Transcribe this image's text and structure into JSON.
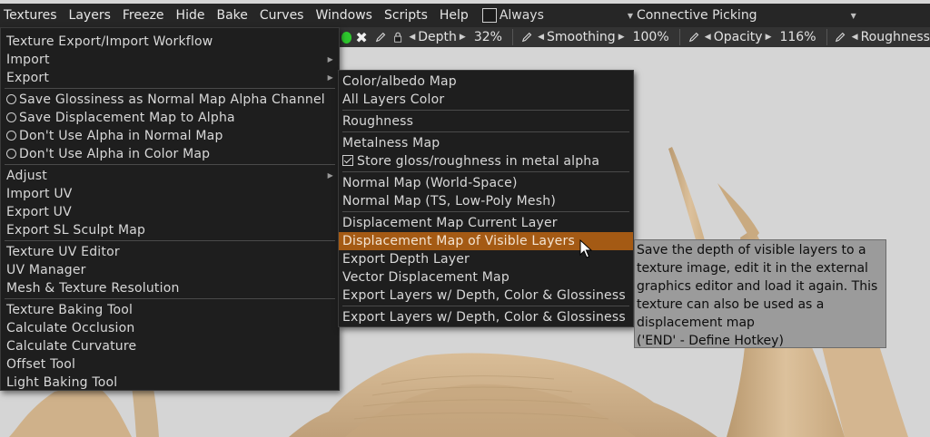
{
  "menubar": {
    "items": [
      "Textures",
      "Layers",
      "Freeze",
      "Hide",
      "Bake",
      "Curves",
      "Windows",
      "Scripts",
      "Help"
    ],
    "always_label": "Always",
    "picking_value": "Connective Picking"
  },
  "toolbar": {
    "depth_label": "Depth",
    "depth_value": "32%",
    "smoothing_label": "Smoothing",
    "smoothing_value": "100%",
    "opacity_label": "Opacity",
    "opacity_value": "116%",
    "roughness_label": "Roughness"
  },
  "main_menu": {
    "items": [
      "Texture Export/Import Workflow",
      "Import",
      "Export",
      "Save Glossiness as Normal Map Alpha Channel",
      "Save Displacement Map to Alpha",
      "Don't Use Alpha in Normal Map",
      "Don't Use Alpha in Color Map",
      "Adjust",
      "Import UV",
      "Export UV",
      "Export SL Sculpt Map",
      "Texture UV Editor",
      "UV Manager",
      "Mesh & Texture Resolution",
      "Texture Baking Tool",
      "Calculate Occlusion",
      "Calculate Curvature",
      "Offset Tool",
      "Light Baking Tool"
    ]
  },
  "export_menu": {
    "items": [
      "Color/albedo Map",
      "All Layers Color",
      "Roughness",
      "Metalness Map",
      "Store gloss/roughness in metal alpha",
      "Normal Map (World-Space)",
      "Normal Map (TS, Low-Poly Mesh)",
      "Displacement Map Current Layer",
      "Displacement Map of Visible Layers",
      "Export Depth Layer",
      "Vector Displacement Map",
      "Export Layers w/ Depth, Color & Glossiness",
      "Export Layers w/ Depth, Color & Glossiness"
    ],
    "highlighted_index": 8
  },
  "tooltip": {
    "lines": [
      "Save the depth of visible layers to a",
      "texture image, edit it in the external",
      "graphics editor and load it again. This",
      "texture can also be used as a",
      "displacement map"
    ],
    "hotkey": "('END' - Define Hotkey)"
  },
  "colors": {
    "menu_bg": "#1e1e1e",
    "highlight": "#a45a14",
    "tooltip_bg": "#9b9b9b",
    "sculpt": "#cdb08a"
  }
}
